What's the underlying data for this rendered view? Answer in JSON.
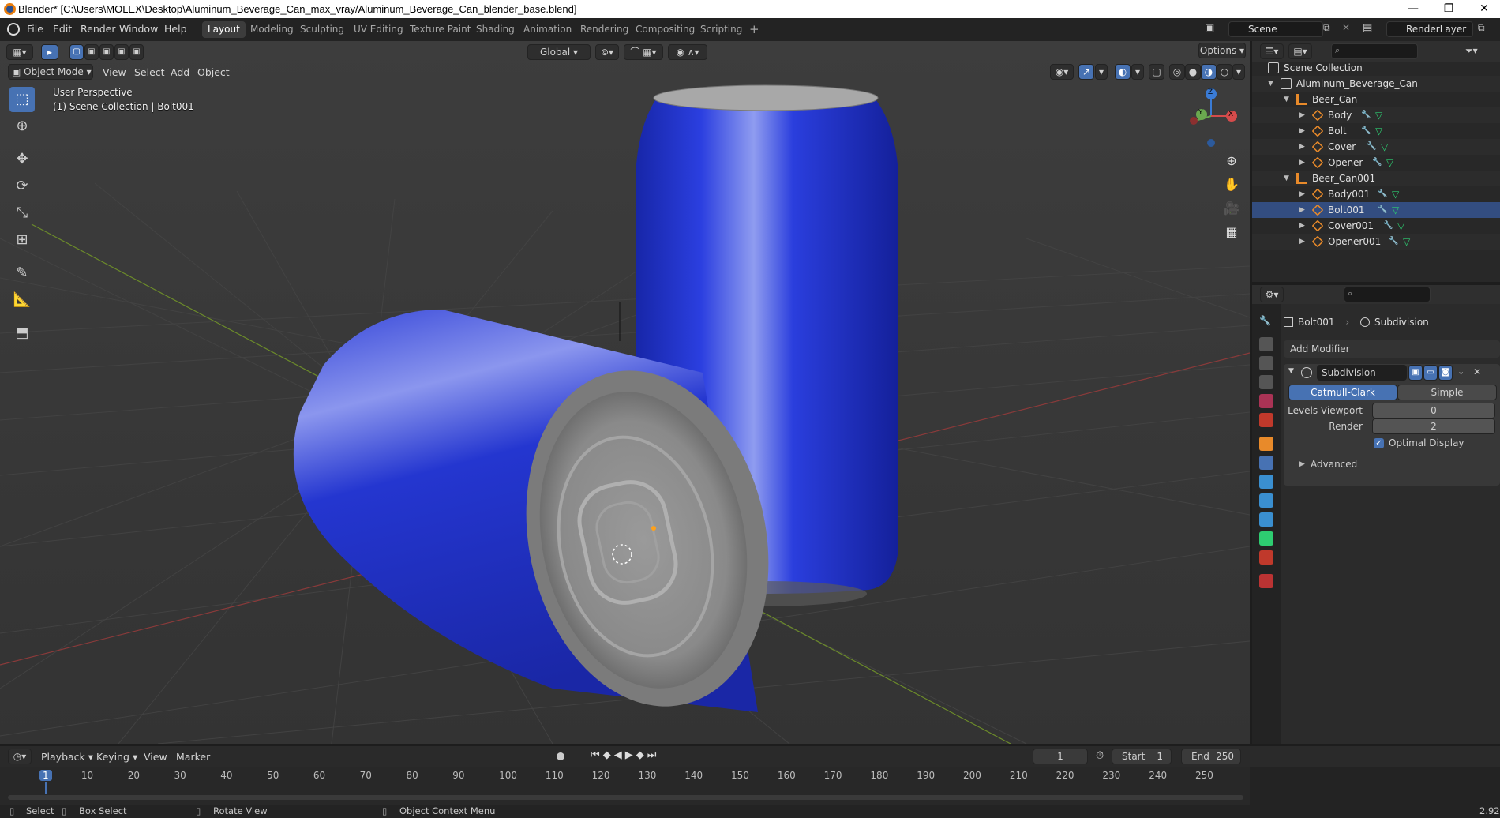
{
  "window": {
    "title": "Blender* [C:\\Users\\MOLEX\\Desktop\\Aluminum_Beverage_Can_max_vray/Aluminum_Beverage_Can_blender_base.blend]",
    "minimize": "—",
    "maximize": "❐",
    "close": "✕"
  },
  "menu": {
    "file": "File",
    "edit": "Edit",
    "render": "Render",
    "window": "Window",
    "help": "Help"
  },
  "workspaces": [
    "Layout",
    "Modeling",
    "Sculpting",
    "UV Editing",
    "Texture Paint",
    "Shading",
    "Animation",
    "Rendering",
    "Compositing",
    "Scripting"
  ],
  "add_workspace": "+",
  "scene": {
    "value": "Scene"
  },
  "render_layer": {
    "value": "RenderLayer"
  },
  "viewport": {
    "mode": "Object Mode",
    "menus": [
      "View",
      "Select",
      "Add",
      "Object"
    ],
    "transform_orientation": "Global",
    "options": "Options",
    "perspective": "User Perspective",
    "collection_info": "(1) Scene Collection | Bolt001",
    "gizmo": {
      "x": "X",
      "y": "Y",
      "z": "Z"
    }
  },
  "outliner": {
    "root": "Scene Collection",
    "items": [
      {
        "label": "Aluminum_Beverage_Can",
        "level": 1,
        "type": "collection",
        "open": true
      },
      {
        "label": "Beer_Can",
        "level": 2,
        "type": "empty",
        "open": true
      },
      {
        "label": "Body",
        "level": 3,
        "type": "mesh"
      },
      {
        "label": "Bolt",
        "level": 3,
        "type": "mesh"
      },
      {
        "label": "Cover",
        "level": 3,
        "type": "mesh"
      },
      {
        "label": "Opener",
        "level": 3,
        "type": "mesh"
      },
      {
        "label": "Beer_Can001",
        "level": 2,
        "type": "empty",
        "open": true
      },
      {
        "label": "Body001",
        "level": 3,
        "type": "mesh"
      },
      {
        "label": "Bolt001",
        "level": 3,
        "type": "mesh",
        "selected": true
      },
      {
        "label": "Cover001",
        "level": 3,
        "type": "mesh"
      },
      {
        "label": "Opener001",
        "level": 3,
        "type": "mesh"
      }
    ]
  },
  "properties": {
    "breadcrumb_object": "Bolt001",
    "breadcrumb_modifier": "Subdivision",
    "add_modifier": "Add Modifier",
    "modifier_name": "Subdivision",
    "catmull": "Catmull-Clark",
    "simple": "Simple",
    "levels_viewport_label": "Levels Viewport",
    "levels_viewport_value": "0",
    "render_label": "Render",
    "render_value": "2",
    "optimal_display": "Optimal Display",
    "advanced": "Advanced"
  },
  "timeline": {
    "menus": [
      "Playback",
      "Keying",
      "View",
      "Marker"
    ],
    "current_frame": "1",
    "start_label": "Start",
    "start_value": "1",
    "end_label": "End",
    "end_value": "250",
    "ticks": [
      "1",
      "10",
      "20",
      "30",
      "40",
      "50",
      "60",
      "70",
      "80",
      "90",
      "100",
      "110",
      "120",
      "130",
      "140",
      "150",
      "160",
      "170",
      "180",
      "190",
      "200",
      "210",
      "220",
      "230",
      "240",
      "250"
    ]
  },
  "status": {
    "select": "Select",
    "box_select": "Box Select",
    "rotate_view": "Rotate View",
    "context_menu": "Object Context Menu",
    "version": "2.92"
  },
  "colors": {
    "accent": "#4772b3",
    "can_blue": "#1f2fc0",
    "can_grey": "#8a8a8a",
    "object_orange": "#e88a2a"
  }
}
